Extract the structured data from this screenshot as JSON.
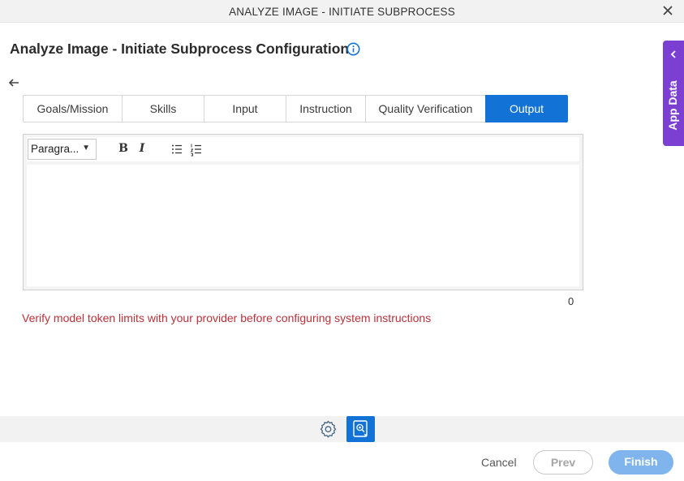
{
  "window": {
    "title": "ANALYZE IMAGE - INITIATE SUBPROCESS",
    "close_icon": "close-icon"
  },
  "page": {
    "heading": "Analyze Image - Initiate Subprocess Configuration",
    "info_icon": "info-icon",
    "back_icon": "back-arrow-icon"
  },
  "tabs": [
    {
      "label": "Goals/Mission",
      "active": false
    },
    {
      "label": "Skills",
      "active": false
    },
    {
      "label": "Input",
      "active": false
    },
    {
      "label": "Instruction",
      "active": false
    },
    {
      "label": "Quality Verification",
      "active": false
    },
    {
      "label": "Output",
      "active": true
    }
  ],
  "editor": {
    "format_select": "Paragra...",
    "bold_label": "B",
    "italic_label": "I",
    "bullet_list_icon": "bullet-list-icon",
    "numbered_list_icon": "numbered-list-icon",
    "content": "",
    "char_count": "0"
  },
  "warning": "Verify model token limits with your provider before configuring system instructions",
  "footer": {
    "gear_icon": "gear-icon",
    "ai_icon": "ai-assist-icon",
    "cancel_label": "Cancel",
    "prev_label": "Prev",
    "finish_label": "Finish"
  },
  "side_panel": {
    "label": "App Data",
    "chevron_icon": "chevron-left-icon"
  },
  "colors": {
    "accent": "#1372d6",
    "side_panel": "#7b3fd2",
    "warning_text": "#b8323a",
    "finish_disabled": "#7fb5ec"
  }
}
